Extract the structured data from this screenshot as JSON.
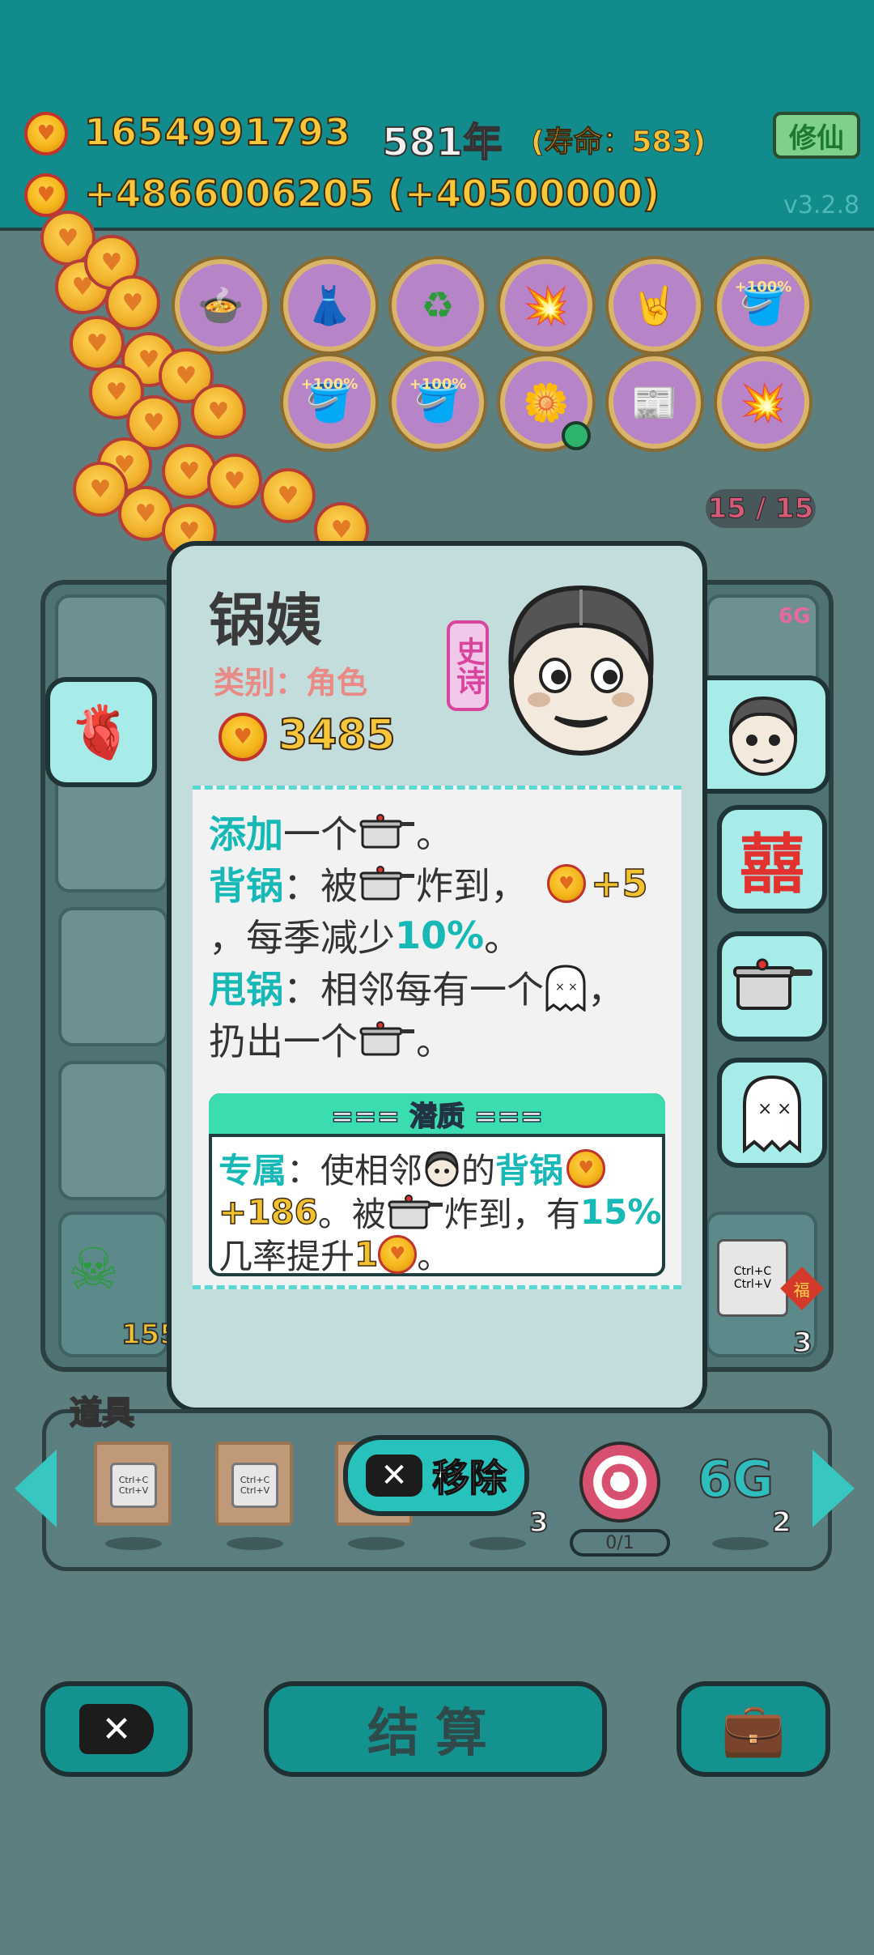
{
  "header": {
    "gold_amount": "1654991793",
    "year": "581年",
    "lifespan": "(寿命：583)",
    "cultivate_label": "修仙",
    "income": "+4866006205 (+40500000)",
    "version": "v3.2.8"
  },
  "relics": {
    "row1": [
      "pressure-cooker-duck",
      "skirt",
      "recycle",
      "mushroom-cloud",
      "rock-hand",
      "pot-plus-100"
    ],
    "row2": [
      "pot-plus-100",
      "pot-plus-100",
      "flower-pot",
      "time-magazine",
      "mushroom-cloud"
    ],
    "pct_label": "+100%"
  },
  "slot_count": "15 / 15",
  "card": {
    "name": "锅姨",
    "category": "类别：角色",
    "rarity": "史诗",
    "price": "3485",
    "desc": {
      "line1_kw": "添加",
      "line1_text": "一个",
      "line1_end": "。",
      "line2_kw": "背锅",
      "line2_text": "：被",
      "line2_mid": "炸到，",
      "line2_bonus": "+5",
      "line3_text": "，每季减少",
      "line3_num": "10%",
      "line3_end": "。",
      "line4_kw": "甩锅",
      "line4_text": "：相邻每有一个",
      "line4_end": "，",
      "line5_text": "扔出一个",
      "line5_end": "。"
    },
    "trait": {
      "header": "=== 潜质 ===",
      "l1_kw": "专属",
      "l1_text": "：使相邻",
      "l1_mid": "的",
      "l1_kw2": "背锅",
      "l2_bonus": "+186",
      "l2_text": "。被",
      "l2_mid": "炸到，有",
      "l2_num": "15%",
      "l3_text": "几率提升",
      "l3_num": "1",
      "l3_end": "。"
    }
  },
  "items": {
    "label": "道具",
    "copy_text": "Ctrl+C Ctrl+V",
    "remove_label": "移除",
    "count_a": "3",
    "target_value": "2",
    "target_counter": "0/1",
    "sixg_label": "6G",
    "count_b": "2"
  },
  "background": {
    "left_count": "155",
    "right_count": "3",
    "fortune": "福"
  },
  "bottom": {
    "settle_label": "结算"
  },
  "colors": {
    "header_bg": "#118b8b",
    "accent": "#16b9b5",
    "gold": "#f7c63a",
    "rarity": "#d8449e"
  }
}
